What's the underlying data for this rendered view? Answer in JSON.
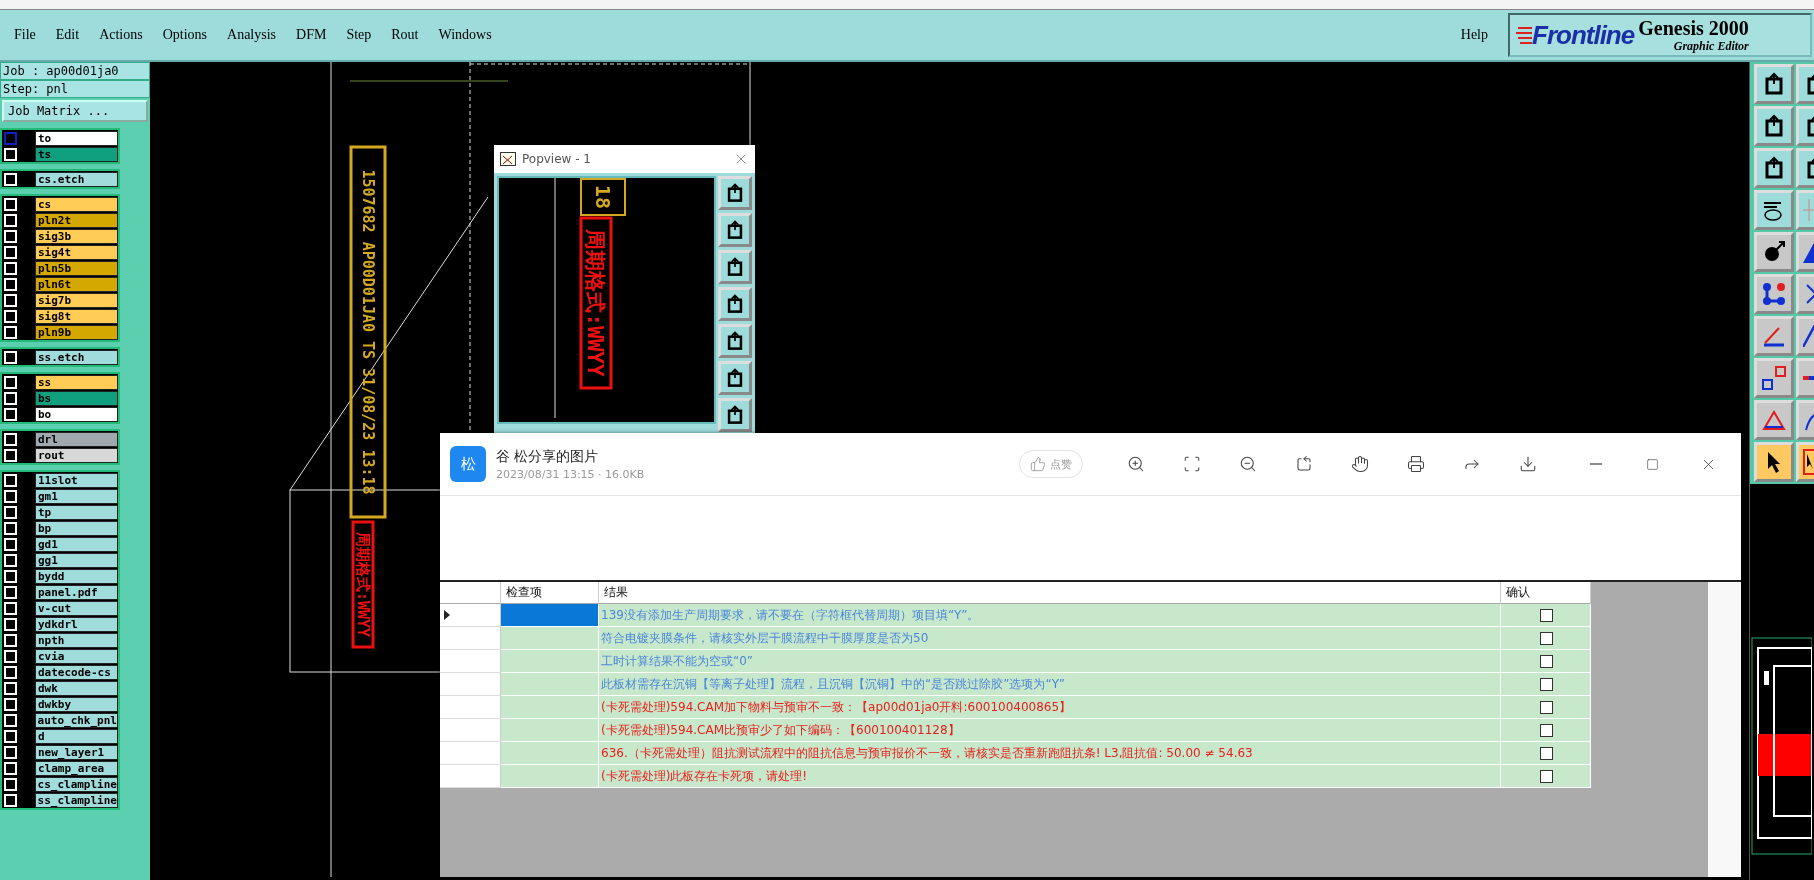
{
  "menu": [
    "File",
    "Edit",
    "Actions",
    "Options",
    "Analysis",
    "DFM",
    "Step",
    "Rout",
    "Windows"
  ],
  "help": "Help",
  "logo": {
    "brand": "Frontline",
    "product": "Genesis 2000",
    "subtitle": "Graphic Editor"
  },
  "job": {
    "job": "Job : ap00d01ja0",
    "step": "Step: pnl",
    "matrix_button": "Job Matrix ..."
  },
  "layer_groups": [
    {
      "layers": [
        {
          "name": "to",
          "color": "#ffffff",
          "selected": true,
          "checked": false
        },
        {
          "name": "ts",
          "color": "#10a080",
          "selected": false,
          "checked": false
        }
      ]
    },
    {
      "layers": [
        {
          "name": "cs.etch",
          "color": "#a0dcdc",
          "selected": false,
          "checked": false
        }
      ]
    },
    {
      "layers": [
        {
          "name": "cs",
          "color": "#ffcc55",
          "selected": false,
          "checked": false
        },
        {
          "name": "pln2t",
          "color": "#d4a800",
          "selected": false,
          "checked": false
        },
        {
          "name": "sig3b",
          "color": "#ffcc55",
          "selected": false,
          "checked": false
        },
        {
          "name": "sig4t",
          "color": "#ffcc55",
          "selected": false,
          "checked": false
        },
        {
          "name": "pln5b",
          "color": "#d4a800",
          "selected": false,
          "checked": false
        },
        {
          "name": "pln6t",
          "color": "#d4a800",
          "selected": false,
          "checked": false
        },
        {
          "name": "sig7b",
          "color": "#ffcc55",
          "selected": false,
          "checked": false
        },
        {
          "name": "sig8t",
          "color": "#ffcc55",
          "selected": false,
          "checked": false
        },
        {
          "name": "pln9b",
          "color": "#d4a800",
          "selected": false,
          "checked": false
        }
      ]
    },
    {
      "layers": [
        {
          "name": "ss.etch",
          "color": "#a0dcdc",
          "selected": false,
          "checked": false
        }
      ]
    },
    {
      "layers": [
        {
          "name": "ss",
          "color": "#ffcc55",
          "selected": false,
          "checked": false
        },
        {
          "name": "bs",
          "color": "#10a080",
          "selected": false,
          "checked": false
        },
        {
          "name": "bo",
          "color": "#ffffff",
          "selected": false,
          "checked": false
        }
      ]
    },
    {
      "layers": [
        {
          "name": "drl",
          "color": "#a0a8b0",
          "selected": false,
          "checked": false
        },
        {
          "name": "rout",
          "color": "#d8d8d8",
          "selected": false,
          "checked": false
        }
      ]
    },
    {
      "layers": [
        {
          "name": "11slot",
          "color": "#a0dcdc",
          "selected": false,
          "checked": false
        },
        {
          "name": "gm1",
          "color": "#a0dcdc",
          "selected": false,
          "checked": false
        },
        {
          "name": "tp",
          "color": "#a0dcdc",
          "selected": false,
          "checked": false
        },
        {
          "name": "bp",
          "color": "#a0dcdc",
          "selected": false,
          "checked": false
        },
        {
          "name": "gd1",
          "color": "#a0dcdc",
          "selected": false,
          "checked": false
        },
        {
          "name": "gg1",
          "color": "#a0dcdc",
          "selected": false,
          "checked": false
        },
        {
          "name": "bydd",
          "color": "#a0dcdc",
          "selected": false,
          "checked": false
        },
        {
          "name": "panel.pdf",
          "color": "#a0dcdc",
          "selected": false,
          "checked": false
        },
        {
          "name": "v-cut",
          "color": "#a0dcdc",
          "selected": false,
          "checked": false
        },
        {
          "name": "ydkdrl",
          "color": "#a0dcdc",
          "selected": false,
          "checked": false
        },
        {
          "name": "npth",
          "color": "#a0dcdc",
          "selected": false,
          "checked": false
        },
        {
          "name": "cvia",
          "color": "#a0dcdc",
          "selected": false,
          "checked": false
        },
        {
          "name": "datecode-cs",
          "color": "#a0dcdc",
          "selected": false,
          "checked": false
        },
        {
          "name": "dwk",
          "color": "#a0dcdc",
          "selected": false,
          "checked": false
        },
        {
          "name": "dwkby",
          "color": "#a0dcdc",
          "selected": false,
          "checked": false
        },
        {
          "name": "auto_chk_pnl",
          "color": "#a0dcdc",
          "selected": false,
          "checked": false
        },
        {
          "name": "d",
          "color": "#a0dcdc",
          "selected": false,
          "checked": false
        },
        {
          "name": "new_layer1",
          "color": "#a0dcdc",
          "selected": false,
          "checked": false
        },
        {
          "name": "clamp_area",
          "color": "#a0dcdc",
          "selected": false,
          "checked": false
        },
        {
          "name": "cs_clampline",
          "color": "#a0dcdc",
          "selected": false,
          "checked": false
        },
        {
          "name": "ss_clampline",
          "color": "#a0dcdc",
          "selected": false,
          "checked": false
        }
      ]
    }
  ],
  "canvas": {
    "board_text": "1507682  AP00D01JA0 TS 31/08/23 13:18",
    "date_format_text": "周期格式:WWYY"
  },
  "popview": {
    "title": "Popview - 1",
    "board_text": "18",
    "date_format_text": "周期格式:WWYY"
  },
  "viewer": {
    "avatar": "松",
    "title": "谷  松分享的图片",
    "meta": "2023/08/31 13:15 · 16.0KB",
    "like": "点赞",
    "table": {
      "columns": [
        "检查项",
        "结果",
        "确认"
      ],
      "rows": [
        {
          "selected": true,
          "result": "139没有添加生产周期要求，请不要在（字符框代替周期）项目填“Y”。",
          "color": "#4a86d8",
          "checked": false
        },
        {
          "selected": false,
          "result": "符合电镀夹膜条件，请核实外层干膜流程中干膜厚度是否为50",
          "color": "#4a86d8",
          "checked": false
        },
        {
          "selected": false,
          "result": "工时计算结果不能为空或“0”",
          "color": "#4a86d8",
          "checked": false
        },
        {
          "selected": false,
          "result": "此板材需存在沉铜【等离子处理】流程，且沉铜【沉铜】中的“是否跳过除胶”选项为“Y”",
          "color": "#4a86d8",
          "checked": false
        },
        {
          "selected": false,
          "result": "(卡死需处理)594.CAM加下物料与预审不一致：【ap00d01ja0开料:600100400865】",
          "color": "#e8201a",
          "checked": false
        },
        {
          "selected": false,
          "result": "(卡死需处理)594.CAM比预审少了如下编码：【600100401128】",
          "color": "#e8201a",
          "checked": false
        },
        {
          "selected": false,
          "result": "636.（卡死需处理）阻抗测试流程中的阻抗信息与预审报价不一致，请核实是否重新跑阻抗条! L3,阻抗值: 50.00 ≠ 54.63",
          "color": "#e8201a",
          "checked": false
        },
        {
          "selected": false,
          "result": "(卡死需处理)此板存在卡死项，请处理!",
          "color": "#e8201a",
          "checked": false
        }
      ]
    }
  },
  "tools": [
    {
      "selected": false
    },
    {
      "selected": false
    },
    {
      "selected": false
    },
    {
      "selected": false
    },
    {
      "selected": false
    },
    {
      "selected": false
    },
    {
      "selected": false
    },
    {
      "selected": false
    },
    {
      "selected": false
    },
    {
      "selected": false
    },
    {
      "selected": false
    },
    {
      "selected": false
    },
    {
      "selected": false
    },
    {
      "selected": false
    },
    {
      "selected": false
    },
    {
      "selected": false
    },
    {
      "selected": false
    },
    {
      "selected": false
    },
    {
      "selected": true
    },
    {
      "selected": true
    }
  ]
}
